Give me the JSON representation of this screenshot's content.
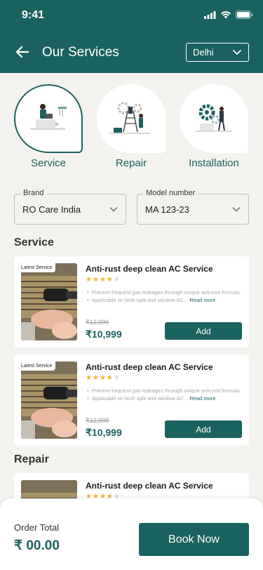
{
  "status_bar": {
    "time": "9:41"
  },
  "header": {
    "title": "Our Services",
    "city": "Delhi"
  },
  "categories": [
    {
      "label": "Service",
      "active": true
    },
    {
      "label": "Repair",
      "active": false
    },
    {
      "label": "Installation",
      "active": false
    }
  ],
  "filters": {
    "brand": {
      "label": "Brand",
      "value": "RO Care India"
    },
    "model": {
      "label": "Model number",
      "value": "MA 123-23"
    }
  },
  "sections": {
    "service": "Service",
    "repair": "Repair"
  },
  "cards": [
    {
      "badge": "Latest Service",
      "title": "Anti-rust deep clean AC Service",
      "rating": 4,
      "bullet_1": "Prevent frequent gas leakages through unique anti-rust formula.",
      "bullet_2": "Applicable on both split and window AC...",
      "read_more": "Read more",
      "old_price": "₹12,999",
      "price": "₹10,999",
      "add_label": "Add"
    },
    {
      "badge": "Latest Service",
      "title": "Anti-rust deep clean AC Service",
      "rating": 4,
      "bullet_1": "Prevent frequent gas leakages through unique anti-rust formula.",
      "bullet_2": "Applicable on both split and window AC...",
      "read_more": "Read more",
      "old_price": "₹12,999",
      "price": "₹10,999",
      "add_label": "Add"
    },
    {
      "title": "Anti-rust deep clean AC Service",
      "rating": 4
    }
  ],
  "footer": {
    "order_total_label": "Order Total",
    "order_total_value": "₹ 00.00",
    "book_label": "Book Now"
  },
  "colors": {
    "primary": "#1a625f",
    "background": "#f4f2ee",
    "star": "#f2b424"
  }
}
